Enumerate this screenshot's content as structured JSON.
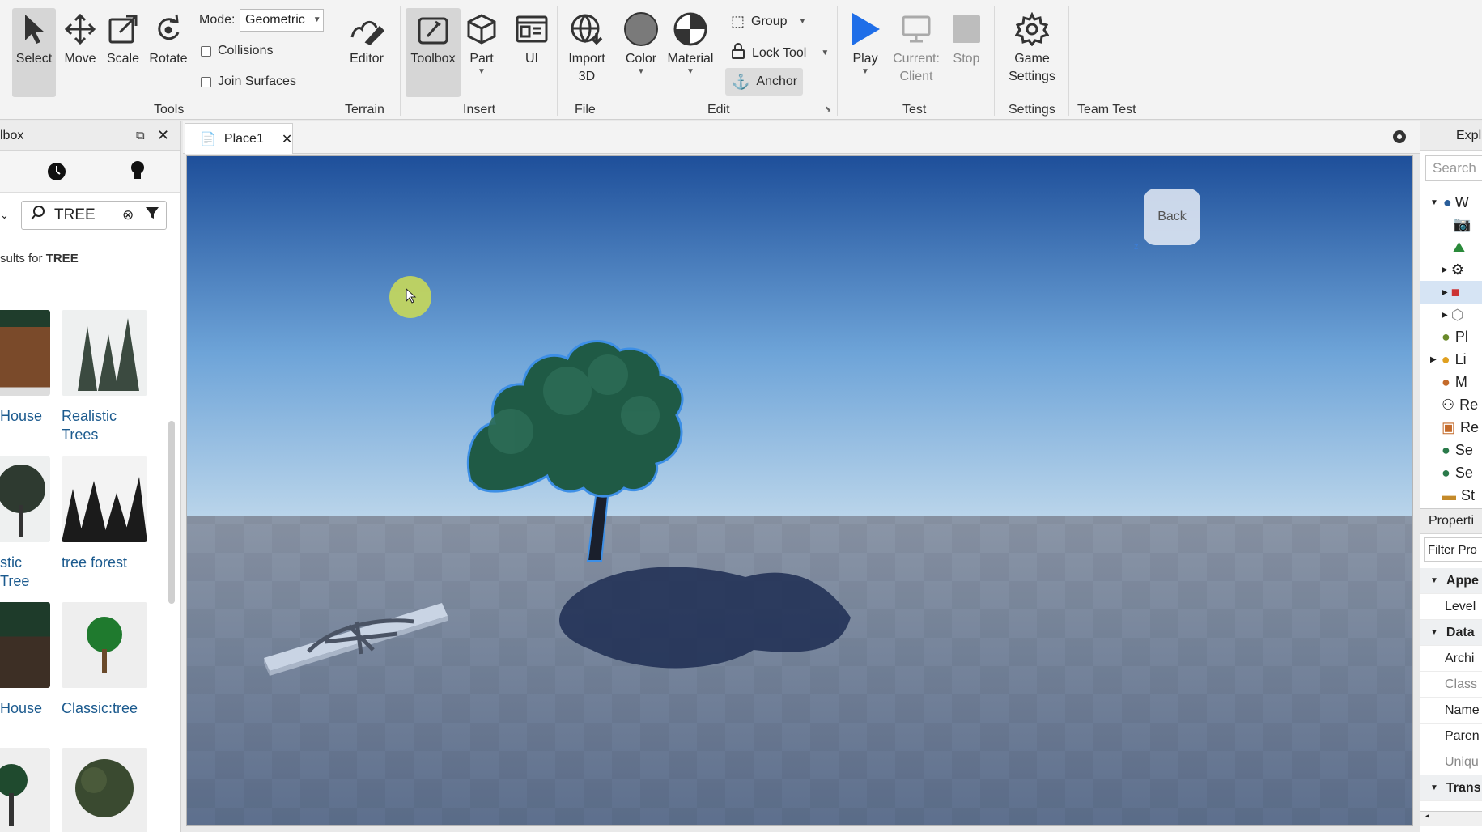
{
  "ribbon": {
    "tools": [
      {
        "label": "Select"
      },
      {
        "label": "Move"
      },
      {
        "label": "Scale"
      },
      {
        "label": "Rotate"
      }
    ],
    "mode_label": "Mode:",
    "mode_value": "Geometric",
    "collisions_label": "Collisions",
    "join_surfaces_label": "Join Surfaces",
    "editor_label": "Editor",
    "toolbox_label": "Toolbox",
    "part_label": "Part",
    "ui_label": "UI",
    "import_label": "Import 3D",
    "color_label": "Color",
    "material_label": "Material",
    "group_label": "Group",
    "lock_tool_label": "Lock Tool",
    "anchor_label": "Anchor",
    "play_label": "Play",
    "current_client_label": "Current: Client",
    "stop_label": "Stop",
    "game_settings_label": "Game Settings",
    "groups": {
      "tools": "Tools",
      "terrain": "Terrain",
      "insert": "Insert",
      "file": "File",
      "edit": "Edit",
      "test": "Test",
      "settings": "Settings",
      "team_test": "Team Test"
    }
  },
  "toolbox": {
    "title": "lbox",
    "search_value": "TREE",
    "results_prefix": "sults for ",
    "results_term": "TREE",
    "assets": [
      {
        "name": "House"
      },
      {
        "name": "Realistic Trees"
      },
      {
        "name": "stic Tree"
      },
      {
        "name": "tree forest"
      },
      {
        "name": "House"
      },
      {
        "name": "Classic:tree"
      },
      {
        "name": ""
      },
      {
        "name": ""
      }
    ]
  },
  "doc_tab": {
    "label": "Place1"
  },
  "viewport": {
    "back_button": "Back"
  },
  "explorer": {
    "title": "Expl",
    "search_placeholder": "Search",
    "items": [
      "W",
      "",
      "",
      "",
      "",
      "",
      "Pl",
      "Li",
      "M",
      "Re",
      "Re",
      "Se",
      "Se",
      "St"
    ]
  },
  "properties": {
    "title": "Properti",
    "filter_placeholder": "Filter Pro",
    "rows": [
      {
        "label": "Appe",
        "section": true
      },
      {
        "label": "Level",
        "section": false
      },
      {
        "label": "Data",
        "section": true
      },
      {
        "label": "Archi",
        "section": false
      },
      {
        "label": "Class",
        "section": false
      },
      {
        "label": "Name",
        "section": false
      },
      {
        "label": "Paren",
        "section": false
      },
      {
        "label": "Uniqu",
        "section": false
      },
      {
        "label": "Trans",
        "section": true
      }
    ]
  }
}
